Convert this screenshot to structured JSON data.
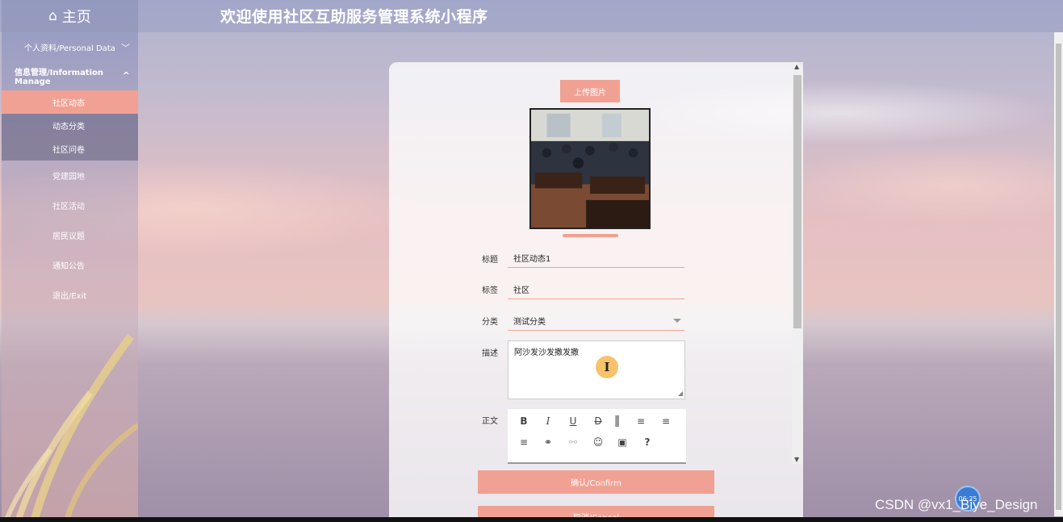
{
  "header": {
    "home_label": "主页",
    "home_icon": "home-icon",
    "app_title": "欢迎使用社区互助服务管理系统小程序"
  },
  "sidebar": {
    "groups": [
      {
        "label": "个人资料/Personal Data",
        "expanded": false
      },
      {
        "label": "信息管理/Information Manage",
        "expanded": true
      }
    ],
    "sub_items": [
      {
        "label": "社区动态",
        "selected": true
      },
      {
        "label": "动态分类",
        "selected": false
      },
      {
        "label": "社区问卷",
        "selected": false
      }
    ],
    "items": [
      {
        "label": "党建园地"
      },
      {
        "label": "社区活动"
      },
      {
        "label": "居民议题"
      },
      {
        "label": "通知公告"
      },
      {
        "label": "退出/Exit"
      }
    ]
  },
  "form": {
    "upload_label": "上传图片",
    "title_label": "标题",
    "title_value": "社区动态1",
    "tag_label": "标签",
    "tag_value": "社区",
    "category_label": "分类",
    "category_value": "测试分类",
    "desc_label": "描述",
    "desc_value": "阿沙发沙发撒发撒",
    "body_label": "正文",
    "confirm_label": "确认/Confirm",
    "cancel_label": "取消/Cancel"
  },
  "editor_toolbar": [
    {
      "icon": "bold-icon",
      "glyph": "B"
    },
    {
      "icon": "italic-icon",
      "glyph": "I"
    },
    {
      "icon": "underline-icon",
      "glyph": "U"
    },
    {
      "icon": "strikethrough-icon",
      "glyph": "D"
    },
    {
      "icon": "color-block-icon",
      "glyph": "▌"
    },
    {
      "icon": "align-left-icon",
      "glyph": "≡"
    },
    {
      "icon": "align-center-icon",
      "glyph": "≡"
    },
    {
      "icon": "align-right-icon",
      "glyph": "≡"
    },
    {
      "icon": "link-icon",
      "glyph": "⚭"
    },
    {
      "icon": "unlink-icon",
      "glyph": "⚯"
    },
    {
      "icon": "emoji-icon",
      "glyph": "☺"
    },
    {
      "icon": "image-icon",
      "glyph": "▣"
    },
    {
      "icon": "help-icon",
      "glyph": "?"
    }
  ],
  "overlay": {
    "clock_text": "06:25",
    "watermark": "CSDN @vx1_Biye_Design"
  },
  "colors": {
    "accent": "#f1a193"
  }
}
